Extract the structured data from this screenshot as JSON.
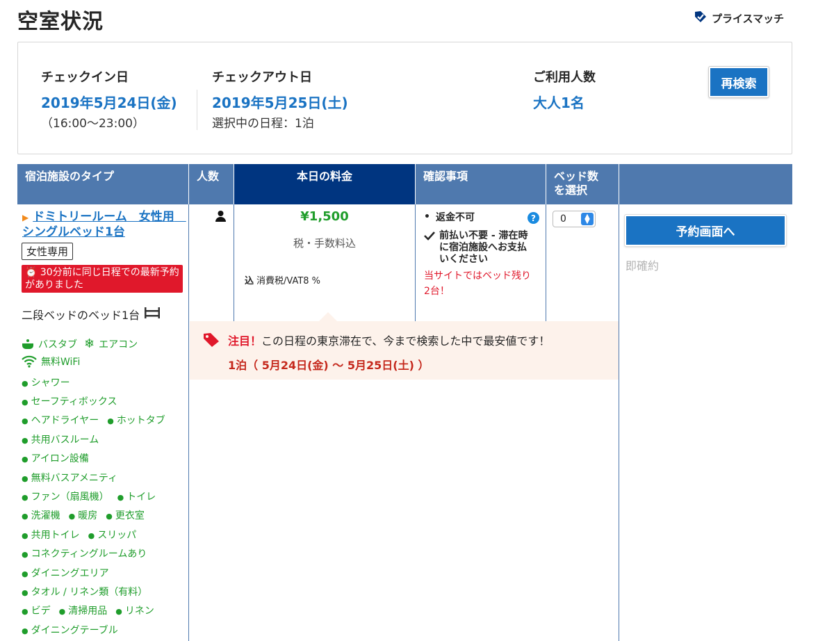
{
  "page": {
    "title": "空室状況",
    "price_match": "プライスマッチ"
  },
  "search": {
    "checkin_label": "チェックイン日",
    "checkin_date": "2019年5月24日(金)",
    "checkin_time": "（16:00〜23:00）",
    "checkout_label": "チェックアウト日",
    "checkout_date": "2019年5月25日(土)",
    "nights_selected": "選択中の日程：1泊",
    "guests_label": "ご利用人数",
    "guests_value": "大人1名",
    "research_label": "再検索"
  },
  "table": {
    "headers": {
      "type": "宿泊施設のタイプ",
      "persons": "人数",
      "price": "本日の料金",
      "confirm": "確認事項",
      "beds_line1": "ベッド数",
      "beds_line2": "を選択"
    }
  },
  "room": {
    "title": "ドミトリールーム　女性用　シングルベッド1台",
    "female_badge": "女性専用",
    "recent_booking": "30分前に同じ日程での最新予約がありました",
    "bed_info": "二段ベッドのベッド1台",
    "amenity_top": {
      "bath": "バスタブ",
      "aircon": "エアコン",
      "wifi": "無料WiFi"
    },
    "amenities": [
      [
        "シャワー"
      ],
      [
        "セーフティボックス"
      ],
      [
        "ヘアドライヤー",
        "ホットタブ"
      ],
      [
        "共用バスルーム"
      ],
      [
        "アイロン設備"
      ],
      [
        "無料バスアメニティ"
      ],
      [
        "ファン（扇風機）",
        "トイレ"
      ],
      [
        "洗濯機",
        "暖房",
        "更衣室"
      ],
      [
        "共用トイレ",
        "スリッパ"
      ],
      [
        "コネクティングルームあり"
      ],
      [
        "ダイニングエリア"
      ],
      [
        "タオル / リネン類（有料）"
      ],
      [
        "ビデ",
        "清掃用品",
        "リネン"
      ],
      [
        "ダイニングテーブル"
      ]
    ]
  },
  "price": {
    "amount": "¥1,500",
    "tax_note": "税・手数料込",
    "vat_prefix": "込",
    "vat_note": "消費税/VAT8 %"
  },
  "confirm": {
    "nonrefundable": "返金不可",
    "pay_at_property": "前払い不要 - 滞在時に宿泊施設へお支払いください",
    "remaining": "当サイトではベッド残り2台！"
  },
  "bed_select": {
    "value": "0"
  },
  "reserve": {
    "button": "予約画面へ",
    "instant": "即確約"
  },
  "notice": {
    "attention": "注目！",
    "message": "この日程の東京滞在で、今まで検索した中で最安値です！",
    "dates": "1泊（ 5月24日(金) 〜 5月25日(土) ）"
  },
  "colors": {
    "link_blue": "#1a73c3",
    "header_blue": "#4f79ae",
    "header_dark": "#003580",
    "green": "#1f9d2b",
    "red": "#e0182b"
  }
}
